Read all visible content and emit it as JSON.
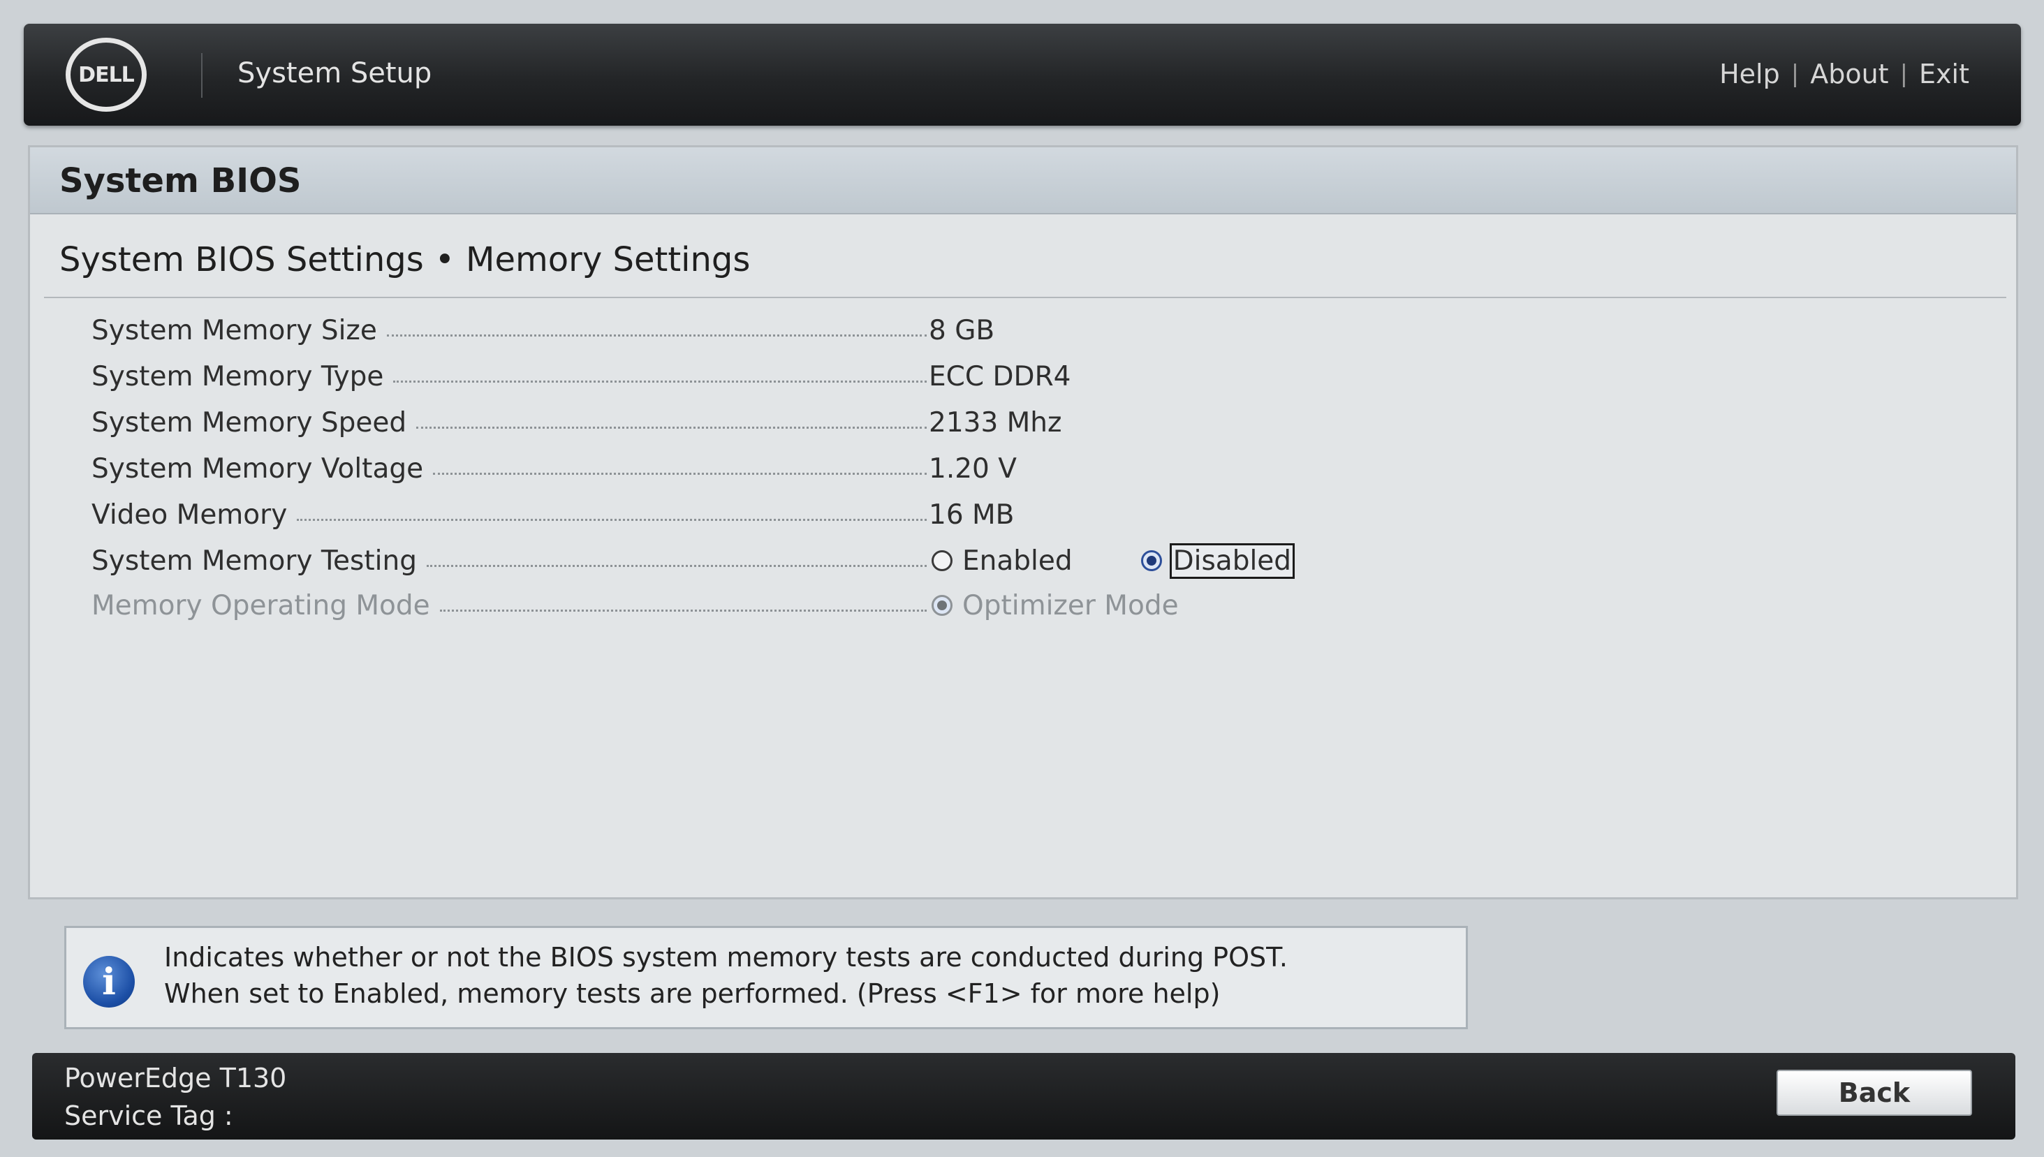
{
  "header": {
    "logo_text": "DELL",
    "title": "System Setup",
    "links": {
      "help": "Help",
      "about": "About",
      "exit": "Exit",
      "separator": "|"
    }
  },
  "panel": {
    "title": "System BIOS",
    "breadcrumb": {
      "parent": "System BIOS Settings",
      "separator": "•",
      "current": "Memory Settings"
    }
  },
  "settings": [
    {
      "label": "System Memory Size",
      "value": "8 GB"
    },
    {
      "label": "System Memory Type",
      "value": "ECC DDR4"
    },
    {
      "label": "System Memory Speed",
      "value": "2133 Mhz"
    },
    {
      "label": "System Memory Voltage",
      "value": "1.20 V"
    },
    {
      "label": "Video Memory",
      "value": "16 MB"
    },
    {
      "label": "System Memory Testing",
      "options": [
        "Enabled",
        "Disabled"
      ],
      "selected": "Disabled"
    },
    {
      "label": "Memory Operating Mode",
      "options": [
        "Optimizer Mode"
      ],
      "selected": "Optimizer Mode",
      "state": "disabled"
    }
  ],
  "info": {
    "icon": "info-icon",
    "line1": "Indicates whether or not the BIOS system memory tests are conducted during POST.",
    "line2": "When set to Enabled, memory tests are performed. (Press <F1> for more help)"
  },
  "footer": {
    "model": "PowerEdge T130",
    "service_tag_label": "Service Tag :",
    "back_label": "Back"
  },
  "colors": {
    "header_bg": "#232527",
    "panel_bg": "#e2e5e7",
    "radio_selected": "#1f3a7a",
    "info_icon": "#1c4fa6"
  }
}
